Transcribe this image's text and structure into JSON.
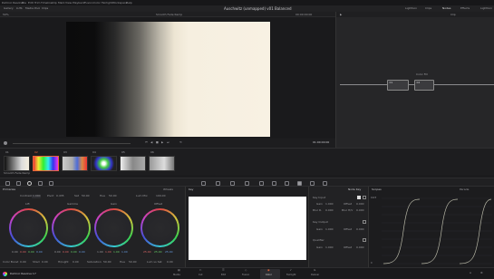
{
  "menubar": {
    "items": [
      "DaVinci Resolve",
      "File",
      "Edit",
      "Trim",
      "Timeline",
      "Clip",
      "Mark",
      "View",
      "Playback",
      "Fusion",
      "Color",
      "Fairlight",
      "Workspace",
      "Help"
    ]
  },
  "toolbar": {
    "left_items": [
      "Gallery",
      "LUTs",
      "Media Pool",
      "Clips"
    ],
    "project_title": "Auschwitz (unmapped) v01 Balanced",
    "right_items": [
      "Lightbox",
      "Clips",
      "Nodes",
      "Effects",
      "Lightbox"
    ]
  },
  "viewer": {
    "zoom": "50%",
    "clip_name": "Smooth Fade Ramp",
    "timecode_top": "00:00:00:00",
    "timecode": "01:00:00:00"
  },
  "node_editor": {
    "header": "Clip",
    "nodes": [
      {
        "label": "01"
      },
      {
        "label": "02",
        "caption": "Color Fill"
      }
    ]
  },
  "timeline_strip": {
    "clips": [
      "01",
      "02",
      "03",
      "04",
      "05",
      "06",
      "07"
    ],
    "clip_caption": "Smooth Fade Ramp"
  },
  "primaries": {
    "title": "Primaries",
    "mode": "Wheels",
    "params_top": [
      "Contrast",
      "1.000",
      "Pivot",
      "0.435",
      "Sat",
      "50.00",
      "Hue",
      "50.00",
      "Lum Mix",
      "100.00"
    ],
    "wheels": [
      {
        "name": "Lift",
        "values": [
          "0.00",
          "0.00",
          "0.00",
          "0.00"
        ]
      },
      {
        "name": "Gamma",
        "values": [
          "0.00",
          "0.00",
          "0.00",
          "0.00"
        ]
      },
      {
        "name": "Gain",
        "values": [
          "1.00",
          "1.00",
          "1.00",
          "1.00"
        ]
      },
      {
        "name": "Offset",
        "values": [
          "25.00",
          "25.00",
          "25.00"
        ]
      }
    ],
    "params_bottom": [
      "Color Boost",
      "0.00",
      "Shad",
      "0.00",
      "Hi/Light",
      "0.00",
      "Saturation",
      "50.00",
      "Hue",
      "50.00",
      "Lum vs Sat",
      "0.00"
    ]
  },
  "key_panel": {
    "title": "Key"
  },
  "qualifier": {
    "title": "Node Key",
    "sections": [
      {
        "name": "Key Input",
        "rows": [
          "Gain",
          "1.000",
          "Offset",
          "0.000",
          "Blur R.",
          "0.000",
          "Blur H/V",
          "0.000"
        ]
      },
      {
        "name": "Key Output",
        "rows": [
          "Gain",
          "1.000",
          "Offset",
          "0.000"
        ]
      },
      {
        "name": "Qualifier",
        "rows": [
          "Gain",
          "1.000",
          "Offset",
          "0.000"
        ]
      }
    ]
  },
  "scopes": {
    "title": "Scopes",
    "mode": "Parade",
    "labels": [
      "1023",
      "896",
      "768",
      "640",
      "512",
      "384",
      "256",
      "128",
      "0"
    ]
  },
  "bottom_nav": {
    "app": "DaVinci Resolve 17",
    "pages": [
      "Media",
      "Cut",
      "Edit",
      "Fusion",
      "Color",
      "Fairlight",
      "Deliver"
    ],
    "active": "Color"
  },
  "colors": {
    "accent": "#e8663a",
    "viewer_light": "#f6efe0"
  }
}
